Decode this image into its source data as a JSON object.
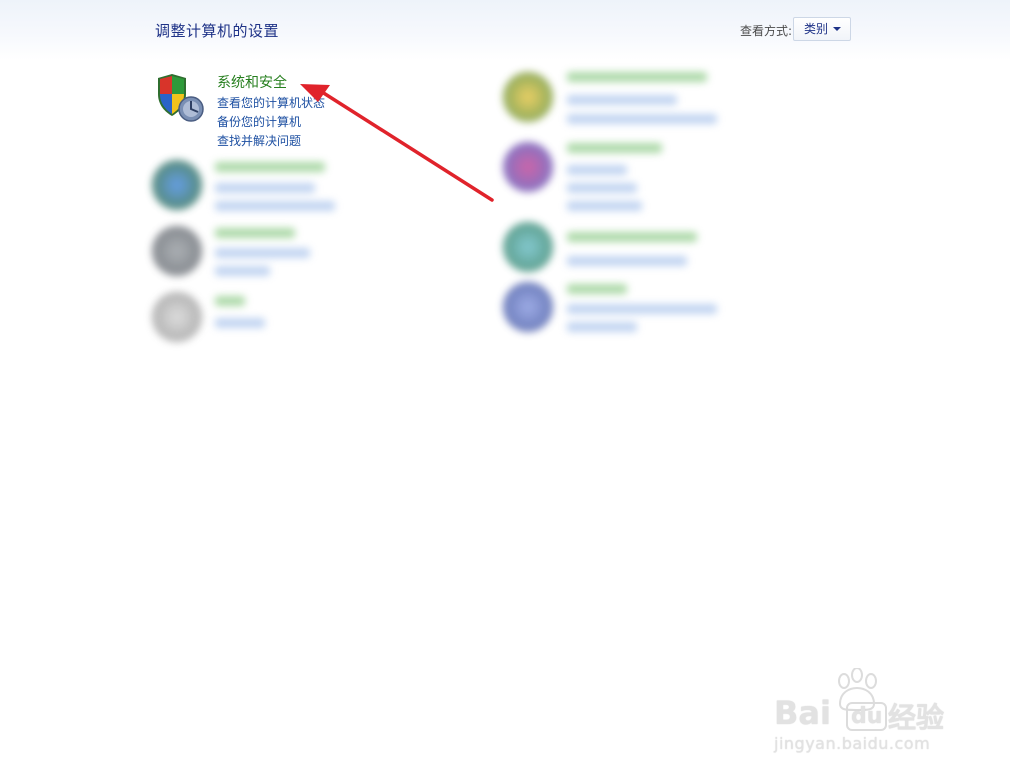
{
  "header": {
    "page_title": "调整计算机的设置",
    "view_by_label": "查看方式:",
    "view_by_value": "类别"
  },
  "system_security": {
    "title": "系统和安全",
    "links": [
      "查看您的计算机状态",
      "备份您的计算机",
      "查找并解决问题"
    ],
    "icon": "shield-icon"
  },
  "colors": {
    "title_green": "#267f1e",
    "link_blue": "#1e50a2",
    "arrow_red": "#e0232b"
  },
  "watermark": {
    "brand_left": "Bai",
    "brand_right": "经验",
    "url": "jingyan.baidu.com"
  }
}
